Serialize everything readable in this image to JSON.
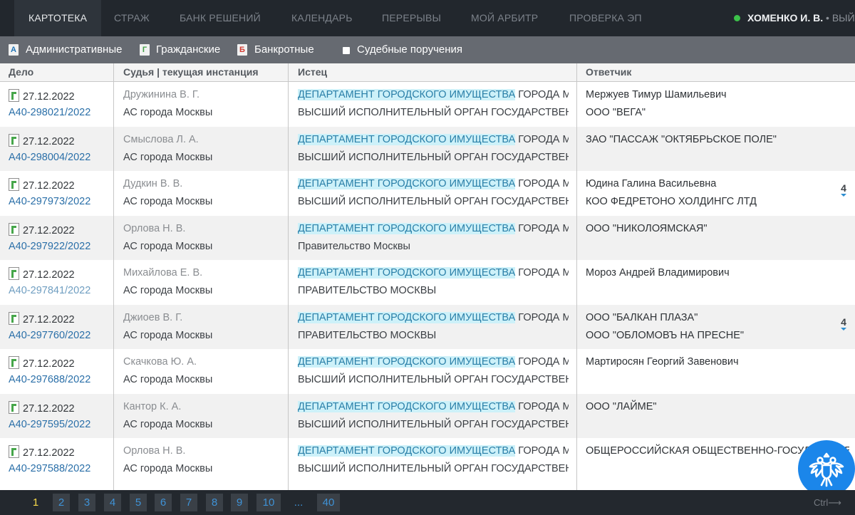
{
  "nav": {
    "tabs": [
      {
        "label": "КАРТОТЕКА",
        "active": true
      },
      {
        "label": "СТРАЖ"
      },
      {
        "label": "БАНК РЕШЕНИЙ"
      },
      {
        "label": "КАЛЕНДАРЬ"
      },
      {
        "label": "ПЕРЕРЫВЫ"
      },
      {
        "label": "МОЙ АРБИТР"
      },
      {
        "label": "ПРОВЕРКА ЭП"
      }
    ],
    "user": {
      "name": "ХОМЕНКО И. В.",
      "logout": " • ВЫЙТИ",
      "status_color": "#3cc24a"
    }
  },
  "filters": {
    "administrative": {
      "letter": "А",
      "label": "Административные"
    },
    "civil": {
      "letter": "Г",
      "label": "Гражданские"
    },
    "bankruptcy": {
      "letter": "Б",
      "label": "Банкротные"
    },
    "court_orders": {
      "label": "Судебные поручения",
      "checked": false
    }
  },
  "table": {
    "columns": [
      "Дело",
      "Судья | текущая инстанция",
      "Истец",
      "Ответчик"
    ],
    "rows": [
      {
        "date": "27.12.2022",
        "case": "А40-298021/2022",
        "visited": false,
        "judge": "Дружинина В. Г.",
        "court": "АС города Москвы",
        "plaintiff_hl": "ДЕПАРТАМЕНТ ГОРОДСКОГО ИМУЩЕСТВА",
        "plaintiff_rest": " ГОРОДА МОСКВЫ",
        "plaintiff2": "ВЫСШИЙ ИСПОЛНИТЕЛЬНЫЙ ОРГАН ГОСУДАРСТВЕННОЙ ВЛАСТИ",
        "defendant1": "Мержуев Тимур Шамильевич",
        "defendant2": "ООО \"ВЕГА\"",
        "badge": ""
      },
      {
        "date": "27.12.2022",
        "case": "А40-298004/2022",
        "visited": false,
        "judge": "Смыслова Л. А.",
        "court": "АС города Москвы",
        "plaintiff_hl": "ДЕПАРТАМЕНТ ГОРОДСКОГО ИМУЩЕСТВА",
        "plaintiff_rest": " ГОРОДА МОСКВЫ",
        "plaintiff2": "ВЫСШИЙ ИСПОЛНИТЕЛЬНЫЙ ОРГАН ГОСУДАРСТВЕННОЙ ВЛАСТИ",
        "defendant1": "ЗАО \"ПАССАЖ \"ОКТЯБРЬСКОЕ ПОЛЕ\"",
        "defendant2": "",
        "badge": ""
      },
      {
        "date": "27.12.2022",
        "case": "А40-297973/2022",
        "visited": false,
        "judge": "Дудкин В. В.",
        "court": "АС города Москвы",
        "plaintiff_hl": "ДЕПАРТАМЕНТ ГОРОДСКОГО ИМУЩЕСТВА",
        "plaintiff_rest": " ГОРОДА МОСКВЫ",
        "plaintiff2": "ВЫСШИЙ ИСПОЛНИТЕЛЬНЫЙ ОРГАН ГОСУДАРСТВЕННОЙ ВЛАСТИ",
        "defendant1": "Юдина Галина Васильевна",
        "defendant2": "КОО ФЕДРЕТОНО ХОЛДИНГС ЛТД",
        "badge": "4"
      },
      {
        "date": "27.12.2022",
        "case": "А40-297922/2022",
        "visited": false,
        "judge": "Орлова Н. В.",
        "court": "АС города Москвы",
        "plaintiff_hl": "ДЕПАРТАМЕНТ ГОРОДСКОГО ИМУЩЕСТВА",
        "plaintiff_rest": " ГОРОДА МОСКВЫ",
        "plaintiff2": "Правительство Москвы",
        "defendant1": "ООО \"НИКОЛОЯМСКАЯ\"",
        "defendant2": "",
        "badge": ""
      },
      {
        "date": "27.12.2022",
        "case": "А40-297841/2022",
        "visited": true,
        "judge": "Михайлова Е. В.",
        "court": "АС города Москвы",
        "plaintiff_hl": "ДЕПАРТАМЕНТ ГОРОДСКОГО ИМУЩЕСТВА",
        "plaintiff_rest": " ГОРОДА МОСКВЫ",
        "plaintiff2": "ПРАВИТЕЛЬСТВО МОСКВЫ",
        "defendant1": "Мороз Андрей Владимирович",
        "defendant2": "",
        "badge": ""
      },
      {
        "date": "27.12.2022",
        "case": "А40-297760/2022",
        "visited": false,
        "judge": "Джиоев В. Г.",
        "court": "АС города Москвы",
        "plaintiff_hl": "ДЕПАРТАМЕНТ ГОРОДСКОГО ИМУЩЕСТВА",
        "plaintiff_rest": " ГОРОДА МОСКВЫ",
        "plaintiff2": "ПРАВИТЕЛЬСТВО МОСКВЫ",
        "defendant1": "ООО \"БАЛКАН ПЛАЗА\"",
        "defendant2": "ООО \"ОБЛОМОВЪ НА ПРЕСНЕ\"",
        "badge": "4"
      },
      {
        "date": "27.12.2022",
        "case": "А40-297688/2022",
        "visited": false,
        "judge": "Скачкова Ю. А.",
        "court": "АС города Москвы",
        "plaintiff_hl": "ДЕПАРТАМЕНТ ГОРОДСКОГО ИМУЩЕСТВА",
        "plaintiff_rest": " ГОРОДА МОСКВЫ",
        "plaintiff2": "ВЫСШИЙ ИСПОЛНИТЕЛЬНЫЙ ОРГАН ГОСУДАРСТВЕННОЙ ВЛАСТИ",
        "defendant1": "Мартиросян Георгий Завенович",
        "defendant2": "",
        "badge": ""
      },
      {
        "date": "27.12.2022",
        "case": "А40-297595/2022",
        "visited": false,
        "judge": "Кантор К. А.",
        "court": "АС города Москвы",
        "plaintiff_hl": "ДЕПАРТАМЕНТ ГОРОДСКОГО ИМУЩЕСТВА",
        "plaintiff_rest": " ГОРОДА МОСКВЫ",
        "plaintiff2": "ВЫСШИЙ ИСПОЛНИТЕЛЬНЫЙ ОРГАН ГОСУДАРСТВЕННОЙ ВЛАСТИ",
        "defendant1": "ООО \"ЛАЙМЕ\"",
        "defendant2": "",
        "badge": ""
      },
      {
        "date": "27.12.2022",
        "case": "А40-297588/2022",
        "visited": false,
        "judge": "Орлова Н. В.",
        "court": "АС города Москвы",
        "plaintiff_hl": "ДЕПАРТАМЕНТ ГОРОДСКОГО ИМУЩЕСТВА",
        "plaintiff_rest": " ГОРОДА МОСКВЫ",
        "plaintiff2": "ВЫСШИЙ ИСПОЛНИТЕЛЬНЫЙ ОРГАН ГОСУДАРСТВЕННОЙ ВЛАСТИ",
        "defendant1": "ОБЩЕРОССИЙСКАЯ ОБЩЕСТВЕННО-ГОСУДАРСТВЕННАЯ",
        "defendant2": "",
        "badge": ""
      }
    ]
  },
  "pagination": {
    "pages": [
      "1",
      "2",
      "3",
      "4",
      "5",
      "6",
      "7",
      "8",
      "9",
      "10",
      "...",
      "40"
    ],
    "current": "1",
    "hint": "Ctrl⟶"
  },
  "colors": {
    "nav_bg": "#22272d",
    "filter_bg": "#666a71",
    "link": "#2a6fa8",
    "highlight": "#cdf1f9",
    "emblem": "#1b86ea",
    "pager_current": "#f6d94a"
  }
}
